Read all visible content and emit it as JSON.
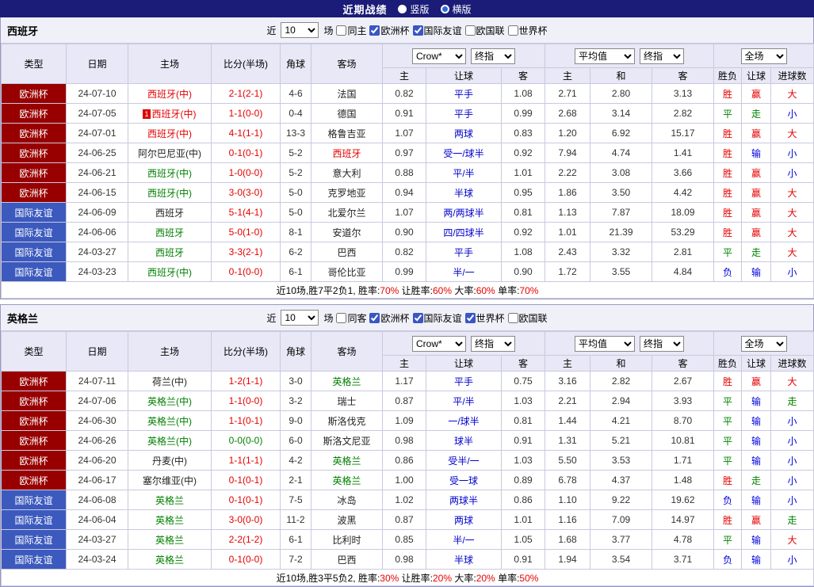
{
  "topbar": {
    "title": "近期战绩",
    "options": [
      {
        "label": "竖版",
        "selected": false
      },
      {
        "label": "横版",
        "selected": true
      }
    ]
  },
  "colors": {
    "navy": "#1b1b78",
    "cup_bg": "#980000",
    "friendly_bg": "#3c5abe",
    "win_red": "#e60000",
    "draw_green": "#008000",
    "lose_blue": "#0000dd"
  },
  "sections": [
    {
      "team": "西班牙",
      "filter": {
        "near": "近",
        "count": "10",
        "matches": "场",
        "checkboxes": [
          {
            "label": "同主",
            "checked": false
          },
          {
            "label": "欧洲杯",
            "checked": true
          },
          {
            "label": "国际友谊",
            "checked": true
          },
          {
            "label": "欧国联",
            "checked": false
          },
          {
            "label": "世界杯",
            "checked": false
          }
        ]
      },
      "columns": [
        "类型",
        "日期",
        "主场",
        "比分(半场)",
        "角球",
        "客场"
      ],
      "odds1": {
        "selects": [
          "Crow*",
          "终指"
        ],
        "cols": [
          "主",
          "让球",
          "客"
        ]
      },
      "odds2": {
        "selects": [
          "平均值",
          "终指"
        ],
        "cols": [
          "主",
          "和",
          "客"
        ]
      },
      "result": {
        "selects": [
          "全场"
        ],
        "cols": [
          "胜负",
          "让球",
          "进球数"
        ]
      },
      "rows": [
        {
          "type": "欧洲杯",
          "tcls": "cup",
          "date": "24-07-10",
          "home": {
            "text": "西班牙(中)",
            "color": "red",
            "badge": ""
          },
          "score": {
            "text": "2-1(2-1)",
            "color": "red"
          },
          "corner": "4-6",
          "away": {
            "text": "法国",
            "color": "black"
          },
          "o1": "0.82",
          "line": "平手",
          "o2": "1.08",
          "a1": "2.71",
          "a2": "2.80",
          "a3": "3.13",
          "r1": {
            "t": "胜",
            "c": "red"
          },
          "r2": {
            "t": "赢",
            "c": "red"
          },
          "r3": {
            "t": "大",
            "c": "red"
          }
        },
        {
          "type": "欧洲杯",
          "tcls": "cup",
          "date": "24-07-05",
          "home": {
            "text": "西班牙(中)",
            "color": "red",
            "badge": "1"
          },
          "score": {
            "text": "1-1(0-0)",
            "color": "red"
          },
          "corner": "0-4",
          "away": {
            "text": "德国",
            "color": "black"
          },
          "o1": "0.91",
          "line": "平手",
          "o2": "0.99",
          "a1": "2.68",
          "a2": "3.14",
          "a3": "2.82",
          "r1": {
            "t": "平",
            "c": "green"
          },
          "r2": {
            "t": "走",
            "c": "green"
          },
          "r3": {
            "t": "小",
            "c": "blue"
          }
        },
        {
          "type": "欧洲杯",
          "tcls": "cup",
          "date": "24-07-01",
          "home": {
            "text": "西班牙(中)",
            "color": "red",
            "badge": ""
          },
          "score": {
            "text": "4-1(1-1)",
            "color": "red"
          },
          "corner": "13-3",
          "away": {
            "text": "格鲁吉亚",
            "color": "black"
          },
          "o1": "1.07",
          "line": "两球",
          "o2": "0.83",
          "a1": "1.20",
          "a2": "6.92",
          "a3": "15.17",
          "r1": {
            "t": "胜",
            "c": "red"
          },
          "r2": {
            "t": "赢",
            "c": "red"
          },
          "r3": {
            "t": "大",
            "c": "red"
          }
        },
        {
          "type": "欧洲杯",
          "tcls": "cup",
          "date": "24-06-25",
          "home": {
            "text": "阿尔巴尼亚(中)",
            "color": "black",
            "badge": ""
          },
          "score": {
            "text": "0-1(0-1)",
            "color": "red"
          },
          "corner": "5-2",
          "away": {
            "text": "西班牙",
            "color": "red"
          },
          "o1": "0.97",
          "line": "受一/球半",
          "o2": "0.92",
          "a1": "7.94",
          "a2": "4.74",
          "a3": "1.41",
          "r1": {
            "t": "胜",
            "c": "red"
          },
          "r2": {
            "t": "输",
            "c": "blue"
          },
          "r3": {
            "t": "小",
            "c": "blue"
          }
        },
        {
          "type": "欧洲杯",
          "tcls": "cup",
          "date": "24-06-21",
          "home": {
            "text": "西班牙(中)",
            "color": "green",
            "badge": ""
          },
          "score": {
            "text": "1-0(0-0)",
            "color": "red"
          },
          "corner": "5-2",
          "away": {
            "text": "意大利",
            "color": "black"
          },
          "o1": "0.88",
          "line": "平/半",
          "o2": "1.01",
          "a1": "2.22",
          "a2": "3.08",
          "a3": "3.66",
          "r1": {
            "t": "胜",
            "c": "red"
          },
          "r2": {
            "t": "赢",
            "c": "red"
          },
          "r3": {
            "t": "小",
            "c": "blue"
          }
        },
        {
          "type": "欧洲杯",
          "tcls": "cup",
          "date": "24-06-15",
          "home": {
            "text": "西班牙(中)",
            "color": "green",
            "badge": ""
          },
          "score": {
            "text": "3-0(3-0)",
            "color": "red"
          },
          "corner": "5-0",
          "away": {
            "text": "克罗地亚",
            "color": "black"
          },
          "o1": "0.94",
          "line": "半球",
          "o2": "0.95",
          "a1": "1.86",
          "a2": "3.50",
          "a3": "4.42",
          "r1": {
            "t": "胜",
            "c": "red"
          },
          "r2": {
            "t": "赢",
            "c": "red"
          },
          "r3": {
            "t": "大",
            "c": "red"
          }
        },
        {
          "type": "国际友谊",
          "tcls": "friendly",
          "date": "24-06-09",
          "home": {
            "text": "西班牙",
            "color": "black",
            "badge": ""
          },
          "score": {
            "text": "5-1(4-1)",
            "color": "red"
          },
          "corner": "5-0",
          "away": {
            "text": "北爱尔兰",
            "color": "black"
          },
          "o1": "1.07",
          "line": "两/两球半",
          "o2": "0.81",
          "a1": "1.13",
          "a2": "7.87",
          "a3": "18.09",
          "r1": {
            "t": "胜",
            "c": "red"
          },
          "r2": {
            "t": "赢",
            "c": "red"
          },
          "r3": {
            "t": "大",
            "c": "red"
          }
        },
        {
          "type": "国际友谊",
          "tcls": "friendly",
          "date": "24-06-06",
          "home": {
            "text": "西班牙",
            "color": "green",
            "badge": ""
          },
          "score": {
            "text": "5-0(1-0)",
            "color": "red"
          },
          "corner": "8-1",
          "away": {
            "text": "安道尔",
            "color": "black"
          },
          "o1": "0.90",
          "line": "四/四球半",
          "o2": "0.92",
          "a1": "1.01",
          "a2": "21.39",
          "a3": "53.29",
          "r1": {
            "t": "胜",
            "c": "red"
          },
          "r2": {
            "t": "赢",
            "c": "red"
          },
          "r3": {
            "t": "大",
            "c": "red"
          }
        },
        {
          "type": "国际友谊",
          "tcls": "friendly",
          "date": "24-03-27",
          "home": {
            "text": "西班牙",
            "color": "green",
            "badge": ""
          },
          "score": {
            "text": "3-3(2-1)",
            "color": "red"
          },
          "corner": "6-2",
          "away": {
            "text": "巴西",
            "color": "black"
          },
          "o1": "0.82",
          "line": "平手",
          "o2": "1.08",
          "a1": "2.43",
          "a2": "3.32",
          "a3": "2.81",
          "r1": {
            "t": "平",
            "c": "green"
          },
          "r2": {
            "t": "走",
            "c": "green"
          },
          "r3": {
            "t": "大",
            "c": "red"
          }
        },
        {
          "type": "国际友谊",
          "tcls": "friendly",
          "date": "24-03-23",
          "home": {
            "text": "西班牙(中)",
            "color": "green",
            "badge": ""
          },
          "score": {
            "text": "0-1(0-0)",
            "color": "red"
          },
          "corner": "6-1",
          "away": {
            "text": "哥伦比亚",
            "color": "black"
          },
          "o1": "0.99",
          "line": "半/一",
          "o2": "0.90",
          "a1": "1.72",
          "a2": "3.55",
          "a3": "4.84",
          "r1": {
            "t": "负",
            "c": "blue"
          },
          "r2": {
            "t": "输",
            "c": "blue"
          },
          "r3": {
            "t": "小",
            "c": "blue"
          }
        }
      ],
      "summary": {
        "prefix": "近10场,胜7平2负1,",
        "stats": [
          {
            "label": "胜率:",
            "value": "70%"
          },
          {
            "label": "让胜率:",
            "value": "60%"
          },
          {
            "label": "大率:",
            "value": "60%"
          },
          {
            "label": "单率:",
            "value": "70%"
          }
        ]
      }
    },
    {
      "team": "英格兰",
      "filter": {
        "near": "近",
        "count": "10",
        "matches": "场",
        "checkboxes": [
          {
            "label": "同客",
            "checked": false
          },
          {
            "label": "欧洲杯",
            "checked": true
          },
          {
            "label": "国际友谊",
            "checked": true
          },
          {
            "label": "世界杯",
            "checked": true
          },
          {
            "label": "欧国联",
            "checked": false
          }
        ]
      },
      "columns": [
        "类型",
        "日期",
        "主场",
        "比分(半场)",
        "角球",
        "客场"
      ],
      "odds1": {
        "selects": [
          "Crow*",
          "终指"
        ],
        "cols": [
          "主",
          "让球",
          "客"
        ]
      },
      "odds2": {
        "selects": [
          "平均值",
          "终指"
        ],
        "cols": [
          "主",
          "和",
          "客"
        ]
      },
      "result": {
        "selects": [
          "全场"
        ],
        "cols": [
          "胜负",
          "让球",
          "进球数"
        ]
      },
      "rows": [
        {
          "type": "欧洲杯",
          "tcls": "cup",
          "date": "24-07-11",
          "home": {
            "text": "荷兰(中)",
            "color": "black",
            "badge": ""
          },
          "score": {
            "text": "1-2(1-1)",
            "color": "red"
          },
          "corner": "3-0",
          "away": {
            "text": "英格兰",
            "color": "green"
          },
          "o1": "1.17",
          "line": "平手",
          "o2": "0.75",
          "a1": "3.16",
          "a2": "2.82",
          "a3": "2.67",
          "r1": {
            "t": "胜",
            "c": "red"
          },
          "r2": {
            "t": "赢",
            "c": "red"
          },
          "r3": {
            "t": "大",
            "c": "red"
          }
        },
        {
          "type": "欧洲杯",
          "tcls": "cup",
          "date": "24-07-06",
          "home": {
            "text": "英格兰(中)",
            "color": "green",
            "badge": ""
          },
          "score": {
            "text": "1-1(0-0)",
            "color": "red"
          },
          "corner": "3-2",
          "away": {
            "text": "瑞士",
            "color": "black"
          },
          "o1": "0.87",
          "line": "平/半",
          "o2": "1.03",
          "a1": "2.21",
          "a2": "2.94",
          "a3": "3.93",
          "r1": {
            "t": "平",
            "c": "green"
          },
          "r2": {
            "t": "输",
            "c": "blue"
          },
          "r3": {
            "t": "走",
            "c": "green"
          }
        },
        {
          "type": "欧洲杯",
          "tcls": "cup",
          "date": "24-06-30",
          "home": {
            "text": "英格兰(中)",
            "color": "green",
            "badge": ""
          },
          "score": {
            "text": "1-1(0-1)",
            "color": "red"
          },
          "corner": "9-0",
          "away": {
            "text": "斯洛伐克",
            "color": "black"
          },
          "o1": "1.09",
          "line": "一/球半",
          "o2": "0.81",
          "a1": "1.44",
          "a2": "4.21",
          "a3": "8.70",
          "r1": {
            "t": "平",
            "c": "green"
          },
          "r2": {
            "t": "输",
            "c": "blue"
          },
          "r3": {
            "t": "小",
            "c": "blue"
          }
        },
        {
          "type": "欧洲杯",
          "tcls": "cup",
          "date": "24-06-26",
          "home": {
            "text": "英格兰(中)",
            "color": "green",
            "badge": ""
          },
          "score": {
            "text": "0-0(0-0)",
            "color": "green"
          },
          "corner": "6-0",
          "away": {
            "text": "斯洛文尼亚",
            "color": "black"
          },
          "o1": "0.98",
          "line": "球半",
          "o2": "0.91",
          "a1": "1.31",
          "a2": "5.21",
          "a3": "10.81",
          "r1": {
            "t": "平",
            "c": "green"
          },
          "r2": {
            "t": "输",
            "c": "blue"
          },
          "r3": {
            "t": "小",
            "c": "blue"
          }
        },
        {
          "type": "欧洲杯",
          "tcls": "cup",
          "date": "24-06-20",
          "home": {
            "text": "丹麦(中)",
            "color": "black",
            "badge": ""
          },
          "score": {
            "text": "1-1(1-1)",
            "color": "red"
          },
          "corner": "4-2",
          "away": {
            "text": "英格兰",
            "color": "green"
          },
          "o1": "0.86",
          "line": "受半/一",
          "o2": "1.03",
          "a1": "5.50",
          "a2": "3.53",
          "a3": "1.71",
          "r1": {
            "t": "平",
            "c": "green"
          },
          "r2": {
            "t": "输",
            "c": "blue"
          },
          "r3": {
            "t": "小",
            "c": "blue"
          }
        },
        {
          "type": "欧洲杯",
          "tcls": "cup",
          "date": "24-06-17",
          "home": {
            "text": "塞尔维亚(中)",
            "color": "black",
            "badge": ""
          },
          "score": {
            "text": "0-1(0-1)",
            "color": "red"
          },
          "corner": "2-1",
          "away": {
            "text": "英格兰",
            "color": "green"
          },
          "o1": "1.00",
          "line": "受一球",
          "o2": "0.89",
          "a1": "6.78",
          "a2": "4.37",
          "a3": "1.48",
          "r1": {
            "t": "胜",
            "c": "red"
          },
          "r2": {
            "t": "走",
            "c": "green"
          },
          "r3": {
            "t": "小",
            "c": "blue"
          }
        },
        {
          "type": "国际友谊",
          "tcls": "friendly",
          "date": "24-06-08",
          "home": {
            "text": "英格兰",
            "color": "green",
            "badge": ""
          },
          "score": {
            "text": "0-1(0-1)",
            "color": "red"
          },
          "corner": "7-5",
          "away": {
            "text": "冰岛",
            "color": "black"
          },
          "o1": "1.02",
          "line": "两球半",
          "o2": "0.86",
          "a1": "1.10",
          "a2": "9.22",
          "a3": "19.62",
          "r1": {
            "t": "负",
            "c": "blue"
          },
          "r2": {
            "t": "输",
            "c": "blue"
          },
          "r3": {
            "t": "小",
            "c": "blue"
          }
        },
        {
          "type": "国际友谊",
          "tcls": "friendly",
          "date": "24-06-04",
          "home": {
            "text": "英格兰",
            "color": "green",
            "badge": ""
          },
          "score": {
            "text": "3-0(0-0)",
            "color": "red"
          },
          "corner": "11-2",
          "away": {
            "text": "波黑",
            "color": "black"
          },
          "o1": "0.87",
          "line": "两球",
          "o2": "1.01",
          "a1": "1.16",
          "a2": "7.09",
          "a3": "14.97",
          "r1": {
            "t": "胜",
            "c": "red"
          },
          "r2": {
            "t": "赢",
            "c": "red"
          },
          "r3": {
            "t": "走",
            "c": "green"
          }
        },
        {
          "type": "国际友谊",
          "tcls": "friendly",
          "date": "24-03-27",
          "home": {
            "text": "英格兰",
            "color": "green",
            "badge": ""
          },
          "score": {
            "text": "2-2(1-2)",
            "color": "red"
          },
          "corner": "6-1",
          "away": {
            "text": "比利时",
            "color": "black"
          },
          "o1": "0.85",
          "line": "半/一",
          "o2": "1.05",
          "a1": "1.68",
          "a2": "3.77",
          "a3": "4.78",
          "r1": {
            "t": "平",
            "c": "green"
          },
          "r2": {
            "t": "输",
            "c": "blue"
          },
          "r3": {
            "t": "大",
            "c": "red"
          }
        },
        {
          "type": "国际友谊",
          "tcls": "friendly",
          "date": "24-03-24",
          "home": {
            "text": "英格兰",
            "color": "green",
            "badge": ""
          },
          "score": {
            "text": "0-1(0-0)",
            "color": "red"
          },
          "corner": "7-2",
          "away": {
            "text": "巴西",
            "color": "black"
          },
          "o1": "0.98",
          "line": "半球",
          "o2": "0.91",
          "a1": "1.94",
          "a2": "3.54",
          "a3": "3.71",
          "r1": {
            "t": "负",
            "c": "blue"
          },
          "r2": {
            "t": "输",
            "c": "blue"
          },
          "r3": {
            "t": "小",
            "c": "blue"
          }
        }
      ],
      "summary": {
        "prefix": "近10场,胜3平5负2,",
        "stats": [
          {
            "label": "胜率:",
            "value": "30%"
          },
          {
            "label": "让胜率:",
            "value": "20%"
          },
          {
            "label": "大率:",
            "value": "20%"
          },
          {
            "label": "单率:",
            "value": "50%"
          }
        ]
      }
    }
  ]
}
